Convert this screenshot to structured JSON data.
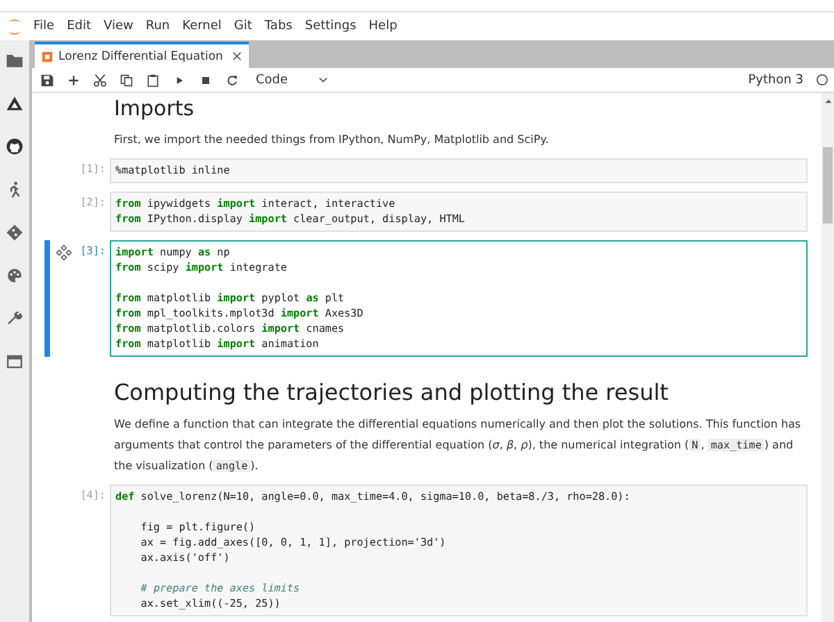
{
  "menu_bar": {
    "items": [
      "File",
      "Edit",
      "View",
      "Run",
      "Kernel",
      "Git",
      "Tabs",
      "Settings",
      "Help"
    ]
  },
  "tabs": [
    {
      "label": "Lorenz Differential Equation",
      "selected": true
    }
  ],
  "toolbar": {
    "cell_type": "Code",
    "kernel": "Python 3"
  },
  "cells": [
    {
      "kind": "h1",
      "text": "Imports"
    },
    {
      "kind": "markdown",
      "segments": [
        {
          "kind": "text",
          "t": "First, we import the needed things from IPython, NumPy, Matplotlib and SciPy."
        }
      ]
    },
    {
      "kind": "code",
      "prompt": "[1]:",
      "selected": false,
      "lines": [
        {
          "kind": "code",
          "text": "%matplotlib inline"
        }
      ]
    },
    {
      "kind": "code",
      "prompt": "[2]:",
      "selected": false,
      "lines": [
        {
          "kind": "code",
          "text": "**from** ipywidgets **import** interact, interactive"
        },
        {
          "kind": "code",
          "text": "**from** IPython.display **import** clear_output, display, HTML"
        }
      ]
    },
    {
      "kind": "code",
      "prompt": "[3]:",
      "selected": true,
      "lines": [
        {
          "kind": "code",
          "text": "**import** numpy **as** np"
        },
        {
          "kind": "code",
          "text": "**from** scipy **import** integrate"
        },
        {
          "kind": "blank"
        },
        {
          "kind": "code",
          "text": "**from** matplotlib **import** pyplot **as** plt"
        },
        {
          "kind": "code",
          "text": "**from** mpl_toolkits.mplot3d **import** Axes3D"
        },
        {
          "kind": "code",
          "text": "**from** matplotlib.colors **import** cnames"
        },
        {
          "kind": "code",
          "text": "**from** matplotlib **import** animation"
        }
      ]
    },
    {
      "kind": "h2",
      "text": "Computing the trajectories and plotting the result"
    },
    {
      "kind": "markdown",
      "segments": [
        {
          "kind": "text",
          "t": "We define a function that can integrate the differential equations numerically and then plot the solutions. This function has arguments that control the parameters of the differential equation (*σ*, *β*, *ρ*), the numerical integration ("
        },
        {
          "kind": "code",
          "t": "N"
        },
        {
          "kind": "text",
          "t": ", "
        },
        {
          "kind": "code",
          "t": "max_time"
        },
        {
          "kind": "text",
          "t": ") and the visualization ("
        },
        {
          "kind": "code",
          "t": "angle"
        },
        {
          "kind": "text",
          "t": ")."
        }
      ]
    },
    {
      "kind": "code",
      "prompt": "[4]:",
      "selected": false,
      "lines": [
        {
          "kind": "code",
          "text": "**def** solve_lorenz(N=10, angle=0.0, max_time=4.0, sigma=10.0, beta=8./3, rho=28.0):"
        },
        {
          "kind": "blank"
        },
        {
          "kind": "code",
          "text": "    fig = plt.figure()"
        },
        {
          "kind": "code",
          "text": "    ax = fig.add_axes([0, 0, 1, 1], projection='3d')"
        },
        {
          "kind": "code",
          "text": "    ax.axis('off')"
        },
        {
          "kind": "blank"
        },
        {
          "kind": "code",
          "text": "    *# prepare the axes limits*"
        },
        {
          "kind": "code",
          "text": "    ax.set_xlim((-25, 25))"
        }
      ]
    }
  ]
}
